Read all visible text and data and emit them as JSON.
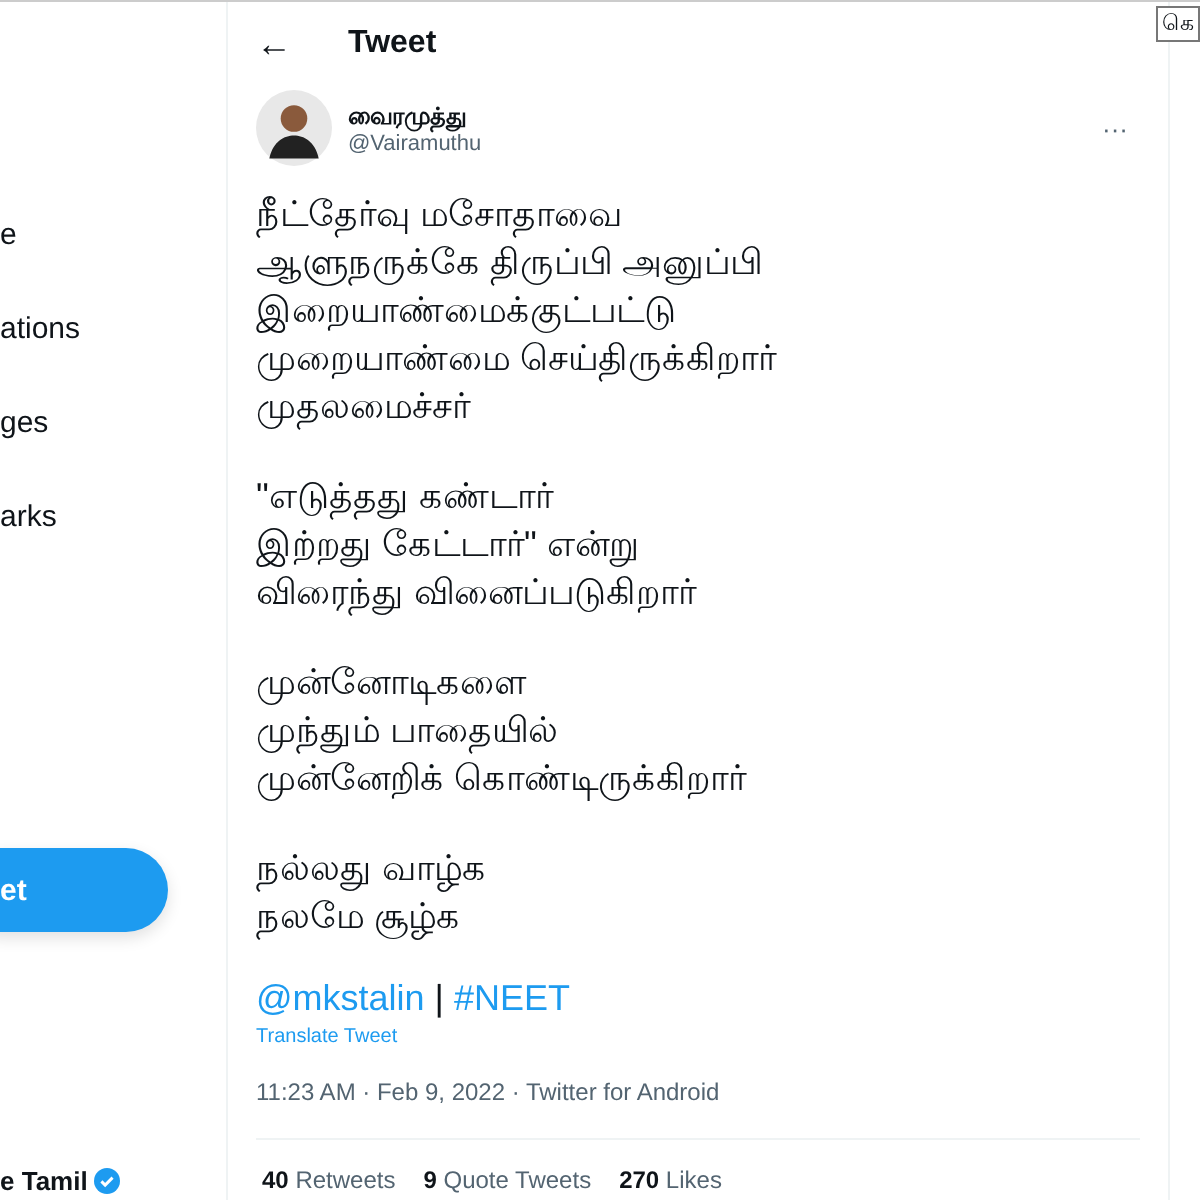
{
  "sidebar": {
    "items": [
      {
        "label": "e",
        "selected": false
      },
      {
        "label": "ations",
        "selected": false
      },
      {
        "label": "ges",
        "selected": false
      },
      {
        "label": "arks",
        "selected": false
      }
    ],
    "tweet_button": "et",
    "account": {
      "name": "e Tamil",
      "verified": true
    }
  },
  "header": {
    "back": "←",
    "title": "Tweet"
  },
  "tweet": {
    "author": {
      "name": "வைரமுத்து",
      "handle": "@Vairamuthu"
    },
    "more": "···",
    "paragraphs": [
      [
        "நீட்தேர்வு மசோதாவை",
        "ஆளுநருக்கே திருப்பி அனுப்பி",
        "இறையாண்மைக்குட்பட்டு",
        "முறையாண்மை செய்திருக்கிறார்",
        "முதலமைச்சர்"
      ],
      [
        "\"எடுத்தது கண்டார்",
        "இற்றது  கேட்டார்\" என்று",
        "விரைந்து வினைப்படுகிறார்"
      ],
      [
        "முன்னோடிகளை",
        "முந்தும் பாதையில்",
        "முன்னேறிக் கொண்டிருக்கிறார்"
      ],
      [
        "நல்லது வாழ்க",
        "நலமே சூழ்க"
      ]
    ],
    "mention": "@mkstalin",
    "separator": "|",
    "hashtag": "#NEET",
    "translate": "Translate Tweet",
    "meta": "11:23 AM · Feb 9, 2022 · Twitter for Android",
    "stats": [
      {
        "count": "40",
        "label": "Retweets"
      },
      {
        "count": "9",
        "label": "Quote Tweets"
      },
      {
        "count": "270",
        "label": "Likes"
      }
    ]
  },
  "tooltip": {
    "text": "கெ"
  }
}
